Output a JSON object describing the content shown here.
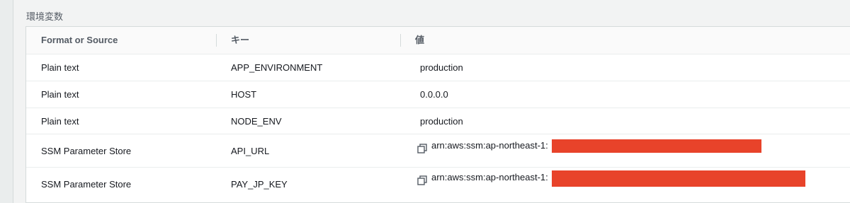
{
  "section": {
    "title": "環境変数"
  },
  "table": {
    "headers": [
      "Format or Source",
      "キー",
      "値"
    ],
    "rows": [
      {
        "source": "Plain text",
        "key": "APP_ENVIRONMENT",
        "value": "production"
      },
      {
        "source": "Plain text",
        "key": "HOST",
        "value": "0.0.0.0"
      },
      {
        "source": "Plain text",
        "key": "NODE_ENV",
        "value": "production"
      },
      {
        "source": "SSM Parameter Store",
        "key": "API_URL",
        "value": "arn:aws:ssm:ap-northeast-1:",
        "icon": "copy-icon",
        "redacted": true
      },
      {
        "source": "SSM Parameter Store",
        "key": "PAY_JP_KEY",
        "value": "arn:aws:ssm:ap-northeast-1:",
        "icon": "copy-icon",
        "redacted": true
      }
    ]
  },
  "colors": {
    "redaction": "#e8432a",
    "header_text": "#545b64",
    "body_text": "#16191f"
  }
}
